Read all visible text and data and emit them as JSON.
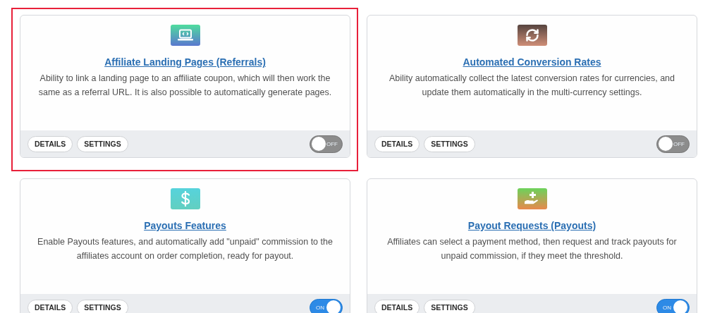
{
  "cards": [
    {
      "kind": "laptop-code",
      "title": "Affiliate Landing Pages (Referrals)",
      "description": "Ability to link a landing page to an affiliate coupon, which will then work the same as a referral URL. It is also possible to automatically generate pages.",
      "buttons": [
        "DETAILS",
        "SETTINGS"
      ],
      "toggle": {
        "on": false,
        "label": "OFF"
      },
      "highlighted": true
    },
    {
      "kind": "refresh",
      "title": "Automated Conversion Rates",
      "description": "Ability automatically collect the latest conversion rates for currencies, and update them automatically in the multi-currency settings.",
      "buttons": [
        "DETAILS",
        "SETTINGS"
      ],
      "toggle": {
        "on": false,
        "label": "OFF"
      },
      "highlighted": false
    },
    {
      "kind": "dollar",
      "title": "Payouts Features",
      "description": "Enable Payouts features, and automatically add \"unpaid\" commission to the affiliates account on order completion, ready for payout.",
      "buttons": [
        "DETAILS",
        "SETTINGS"
      ],
      "toggle": {
        "on": true,
        "label": "ON"
      },
      "highlighted": false
    },
    {
      "kind": "hand-plus",
      "title": "Payout Requests (Payouts)",
      "description": "Affiliates can select a payment method, then request and track payouts for unpaid commission, if they meet the threshold.",
      "buttons": [
        "DETAILS",
        "SETTINGS"
      ],
      "toggle": {
        "on": true,
        "label": "ON"
      },
      "highlighted": false
    }
  ]
}
